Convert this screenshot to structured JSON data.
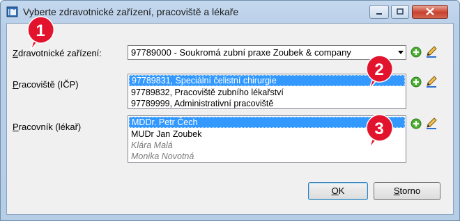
{
  "window": {
    "title": "Vyberte zdravotnické zařízení, pracoviště a lékaře"
  },
  "form": {
    "facility": {
      "label_underlined": "Z",
      "label_rest": "dravotnické zařízení:",
      "value": "97789000 - Soukromá zubní praxe Zoubek & company"
    },
    "workplace": {
      "label_underlined": "P",
      "label_rest": "racoviště (IČP)",
      "items": [
        "97789831, Speciální čelistní chirurgie",
        "97789832, Pracoviště zubního lékařství",
        "97789999, Administrativní pracoviště"
      ]
    },
    "worker": {
      "label_underlined": "P",
      "label_rest": "racovník (lékař)",
      "items": [
        "MDDr. Petr Čech",
        "MUDr Jan Zoubek",
        "Klára Malá",
        "Monika Novotná"
      ]
    }
  },
  "badges": [
    "1",
    "2",
    "3"
  ],
  "buttons": {
    "ok_underlined": "O",
    "ok_rest": "K",
    "cancel_underlined": "S",
    "cancel_rest": "torno"
  },
  "colors": {
    "selection": "#3399ff",
    "badge": "#e2142d"
  }
}
